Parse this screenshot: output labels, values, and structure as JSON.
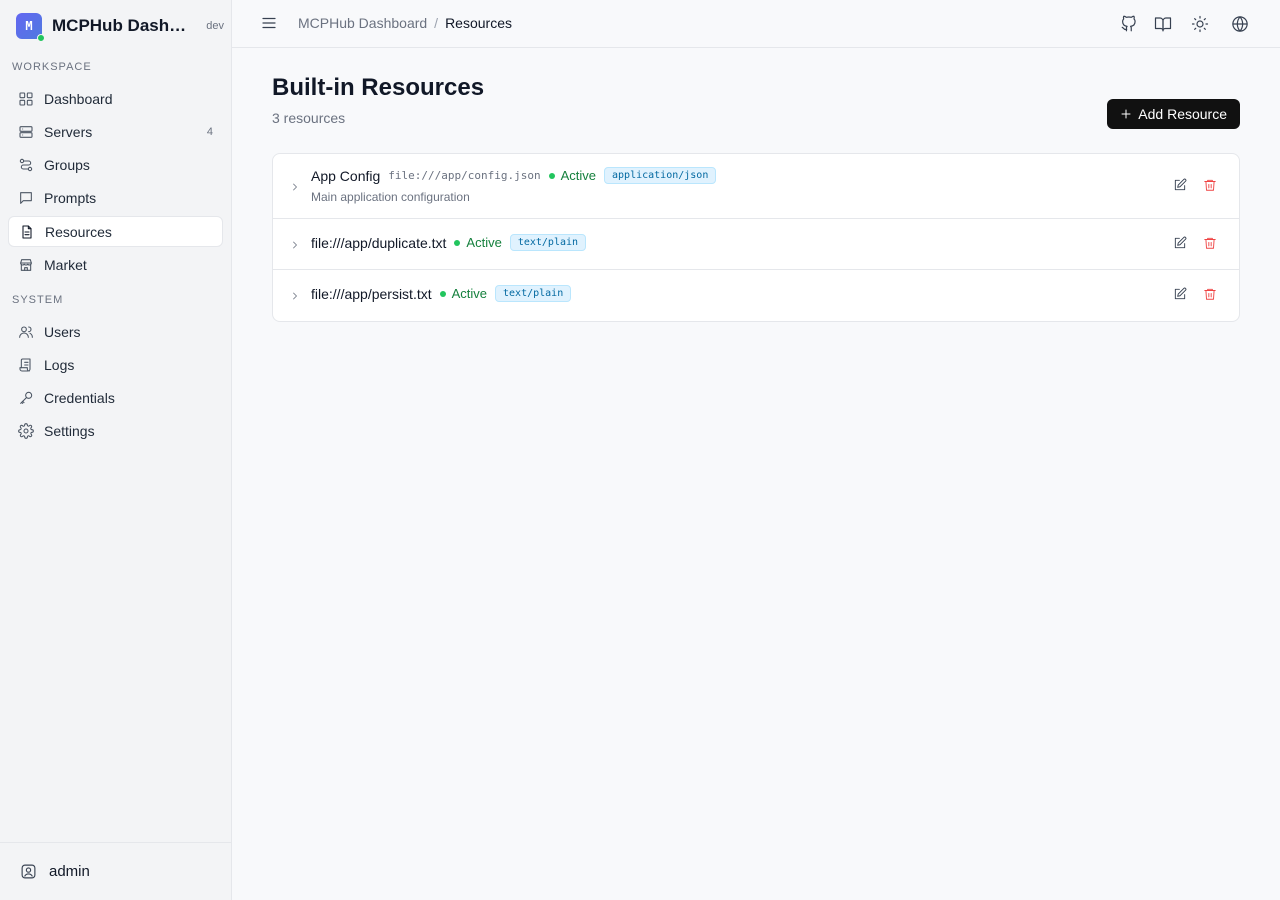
{
  "brand": {
    "logo_letter": "M",
    "title": "MCPHub Dashboard",
    "env": "dev"
  },
  "sidebar": {
    "workspace_label": "WORKSPACE",
    "workspace_items": [
      {
        "label": "Dashboard",
        "icon": "grid-icon"
      },
      {
        "label": "Servers",
        "icon": "server-icon",
        "count": "4"
      },
      {
        "label": "Groups",
        "icon": "groups-icon"
      },
      {
        "label": "Prompts",
        "icon": "message-icon"
      },
      {
        "label": "Resources",
        "icon": "file-icon",
        "active": true
      },
      {
        "label": "Market",
        "icon": "store-icon"
      }
    ],
    "system_label": "SYSTEM",
    "system_items": [
      {
        "label": "Users",
        "icon": "users-icon"
      },
      {
        "label": "Logs",
        "icon": "logs-icon"
      },
      {
        "label": "Credentials",
        "icon": "key-icon"
      },
      {
        "label": "Settings",
        "icon": "gear-icon"
      }
    ],
    "user": "admin"
  },
  "header": {
    "breadcrumb_root": "MCPHub Dashboard",
    "breadcrumb_sep": "/",
    "breadcrumb_current": "Resources"
  },
  "page": {
    "title": "Built-in Resources",
    "subtitle": "3 resources",
    "add_button": "Add Resource"
  },
  "resources": [
    {
      "name": "App Config",
      "uri": "file:///app/config.json",
      "status": "Active",
      "mime": "application/json",
      "description": "Main application configuration"
    },
    {
      "name": "file:///app/duplicate.txt",
      "status": "Active",
      "mime": "text/plain"
    },
    {
      "name": "file:///app/persist.txt",
      "status": "Active",
      "mime": "text/plain"
    }
  ],
  "colors": {
    "accent": "#111111",
    "active_status": "#15803d",
    "delete": "#ef4444",
    "mime_badge": "#e0f2fe"
  }
}
